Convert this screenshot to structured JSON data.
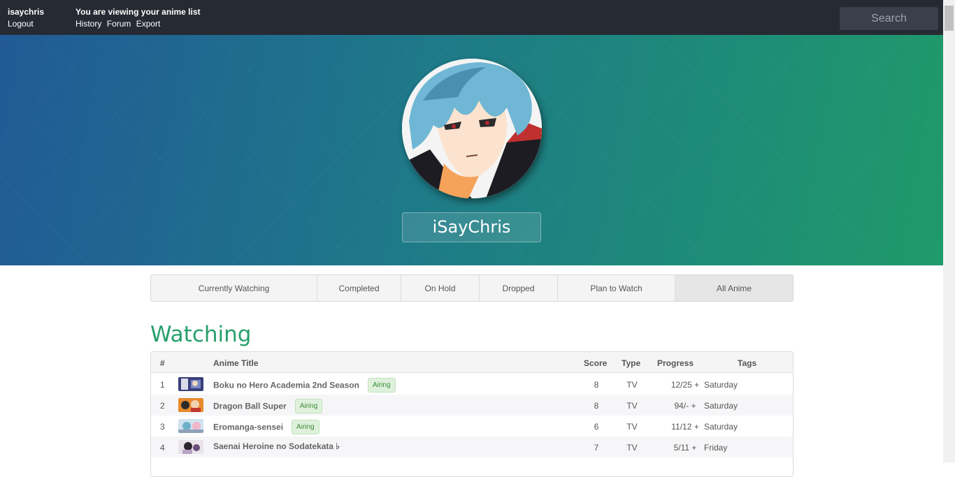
{
  "topbar": {
    "username": "isaychris",
    "logout": "Logout",
    "viewing_text": "You are viewing your anime list",
    "links": [
      "History",
      "Forum",
      "Export"
    ],
    "search_placeholder": "Search"
  },
  "profile": {
    "display_name": "iSayChris"
  },
  "tabs": [
    {
      "label": "Currently Watching"
    },
    {
      "label": "Completed"
    },
    {
      "label": "On Hold"
    },
    {
      "label": "Dropped"
    },
    {
      "label": "Plan to Watch"
    },
    {
      "label": "All Anime"
    }
  ],
  "section": {
    "title": "Watching"
  },
  "table": {
    "columns": {
      "num": "#",
      "title": "Anime Title",
      "score": "Score",
      "type": "Type",
      "progress": "Progress",
      "tags": "Tags"
    },
    "rows": [
      {
        "num": "1",
        "title": "Boku no Hero Academia 2nd Season",
        "badge": "Airing",
        "score": "8",
        "type": "TV",
        "progress": "12/25 +",
        "tags": "Saturday"
      },
      {
        "num": "2",
        "title": "Dragon Ball Super",
        "badge": "Airing",
        "score": "8",
        "type": "TV",
        "progress": "94/- +",
        "tags": "Saturday"
      },
      {
        "num": "3",
        "title": "Eromanga-sensei",
        "badge": "Airing",
        "score": "6",
        "type": "TV",
        "progress": "11/12 +",
        "tags": "Saturday"
      },
      {
        "num": "4",
        "title": "Saenai Heroine no Sodatekata ♭",
        "badge": "",
        "score": "7",
        "type": "TV",
        "progress": "5/11 +",
        "tags": "Friday"
      }
    ]
  },
  "colors": {
    "topbar_bg": "#262a33",
    "accent_green": "#27a06b",
    "badge_bg": "#dff1dc",
    "badge_text": "#3c8a3a"
  }
}
